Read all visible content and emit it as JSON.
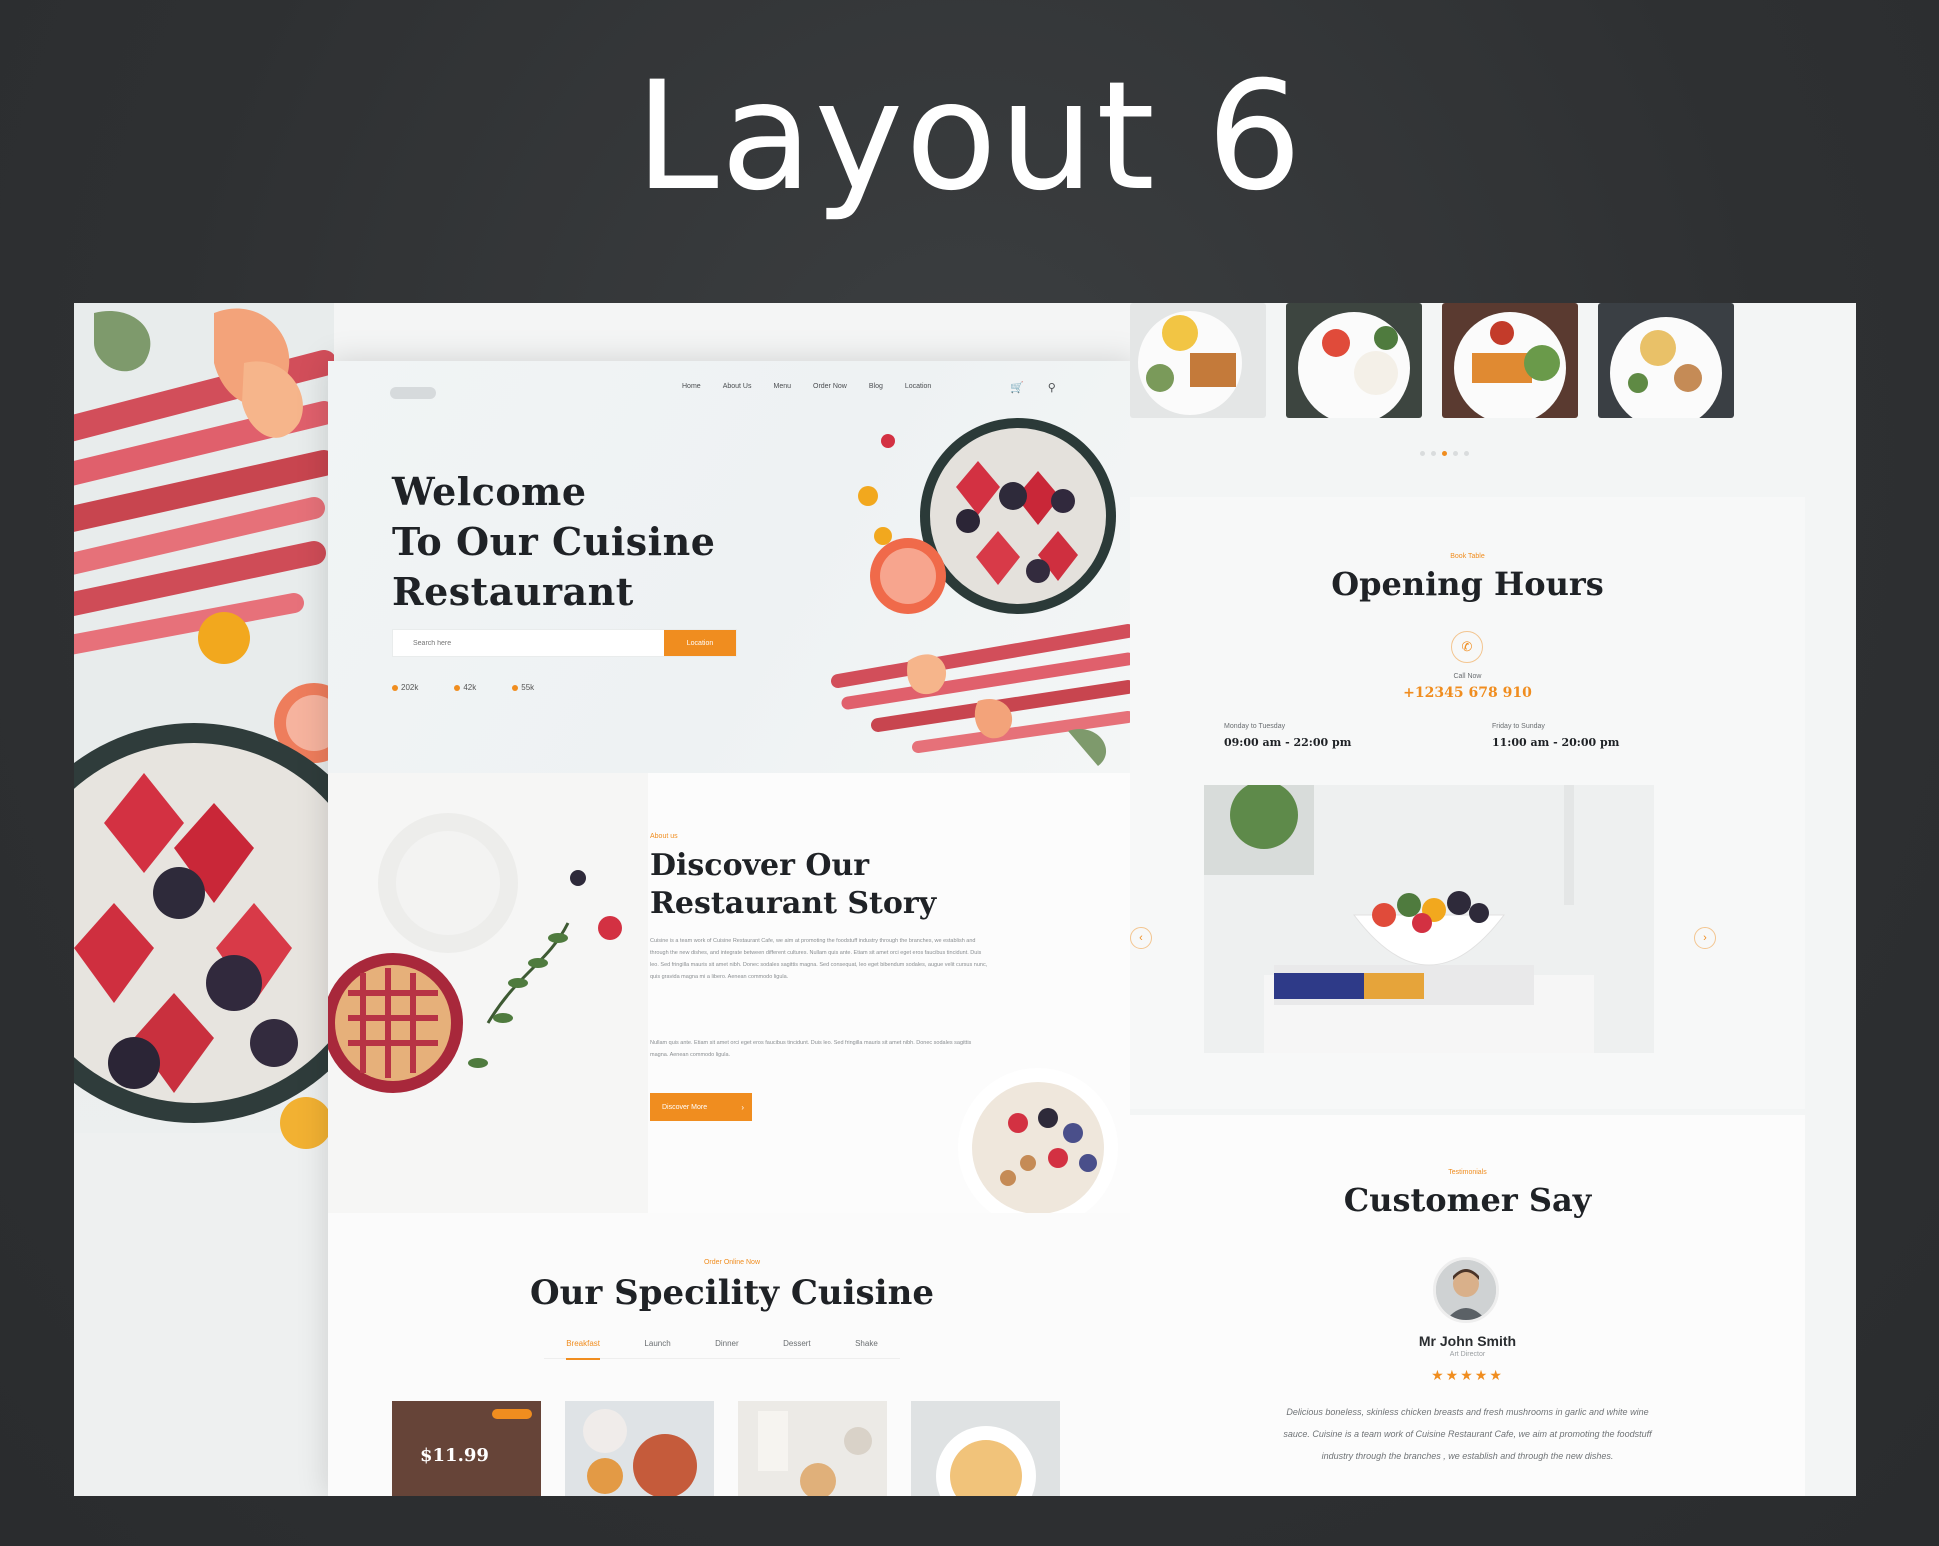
{
  "slide_title": "Layout 6",
  "left_page": {
    "nav": {
      "links": [
        "Home",
        "About Us",
        "Menu",
        "Order Now",
        "Blog",
        "Location"
      ],
      "cart_icon": "cart-icon",
      "search_icon": "search-icon"
    },
    "hero": {
      "title_line1": "Welcome",
      "title_line2": "To Our Cuisine",
      "title_line3": "Restaurant",
      "search_placeholder": "Search here",
      "search_button": "Location",
      "stats": [
        "202k",
        "42k",
        "55k"
      ]
    },
    "about": {
      "kicker": "About us",
      "title_line1": "Discover Our",
      "title_line2": "Restaurant Story",
      "paragraph1": "Cuisine is a team work of Cuisine Restaurant Cafe, we aim at promoting the foodstuff industry through the branches, we establish and through the new dishes, and integrate between different cultures. Nullam quis ante. Etiam sit amet orci eget eros faucibus tincidunt. Duis leo. Sed fringilla mauris sit amet nibh. Donec sodales sagittis magna. Sed consequat, leo eget bibendum sodales, augue velit cursus nunc, quis gravida magna mi a libero. Aenean commodo ligula.",
      "paragraph2": "Nullam quis ante. Etiam sit amet orci eget eros faucibus tincidunt. Duis leo. Sed fringilla mauris sit amet nibh. Donec sodales sagittis magna. Aenean commodo ligula.",
      "button": "Discover More"
    },
    "specialty": {
      "kicker": "Order Online Now",
      "title": "Our Specility Cuisine",
      "tabs": [
        "Breakfast",
        "Launch",
        "Dinner",
        "Dessert",
        "Shake"
      ],
      "active_tab": "Breakfast",
      "featured_price": "$11.99"
    }
  },
  "right_page": {
    "carousel_dots": 5,
    "carousel_active_dot": 2,
    "hours": {
      "kicker": "Book Table",
      "title": "Opening Hours",
      "call_label": "Call Now",
      "phone": "+12345 678 910",
      "slot1_label": "Monday to Tuesday",
      "slot1_time": "09:00 am - 22:00 pm",
      "slot2_label": "Friday to Sunday",
      "slot2_time": "11:00 am - 20:00 pm"
    },
    "testimonials": {
      "kicker": "Testimonials",
      "title": "Customer Say",
      "name": "Mr John Smith",
      "role": "Art Director",
      "rating": 5,
      "stars": "★★★★★",
      "quote_line1": "Delicious boneless, skinless chicken breasts and fresh mushrooms in garlic and white wine",
      "quote_line2": "sauce. Cuisine is a team work of Cuisine Restaurant Cafe, we aim at promoting the foodstuff",
      "quote_line3": "industry through the branches , we establish and through the new dishes."
    }
  },
  "colors": {
    "accent": "#f08d1f",
    "backdrop": "#2e3032",
    "heading_text": "#1f2226"
  }
}
